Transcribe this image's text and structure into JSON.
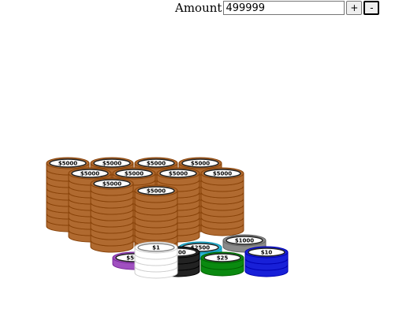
{
  "controls": {
    "amount_label": "Amount",
    "amount_value": "499999",
    "increment_label": "+",
    "decrement_label": "-"
  },
  "chip_piles": [
    {
      "denomination": "$5000",
      "color": "#b06a30",
      "count": 99
    },
    {
      "denomination": "$1000",
      "color": "#8a8a8a",
      "count": 4
    },
    {
      "denomination": "$2500",
      "color": "#2fb8d8",
      "count": 1
    },
    {
      "denomination": "$500",
      "color": "#a050c0",
      "count": 1
    },
    {
      "denomination": "$100",
      "color": "#222222",
      "count": 4
    },
    {
      "denomination": "$25",
      "color": "#0a8a10",
      "count": 3
    },
    {
      "denomination": "$10",
      "color": "#1820d8",
      "count": 4
    },
    {
      "denomination": "$1",
      "color": "#ffffff",
      "count": 4
    }
  ]
}
